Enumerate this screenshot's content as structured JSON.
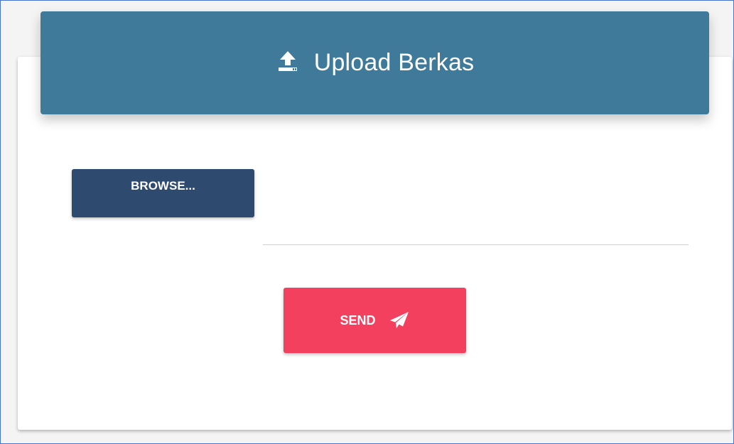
{
  "header": {
    "title": "Upload Berkas",
    "icon": "upload-icon"
  },
  "form": {
    "browse_label": "BROWSE...",
    "file_name_value": "",
    "send_label": "SEND",
    "send_icon": "paper-plane-icon"
  },
  "colors": {
    "header_bg": "#3f7a9a",
    "browse_bg": "#2e4a6e",
    "send_bg": "#f4405f",
    "frame_border": "#4a74c9"
  }
}
